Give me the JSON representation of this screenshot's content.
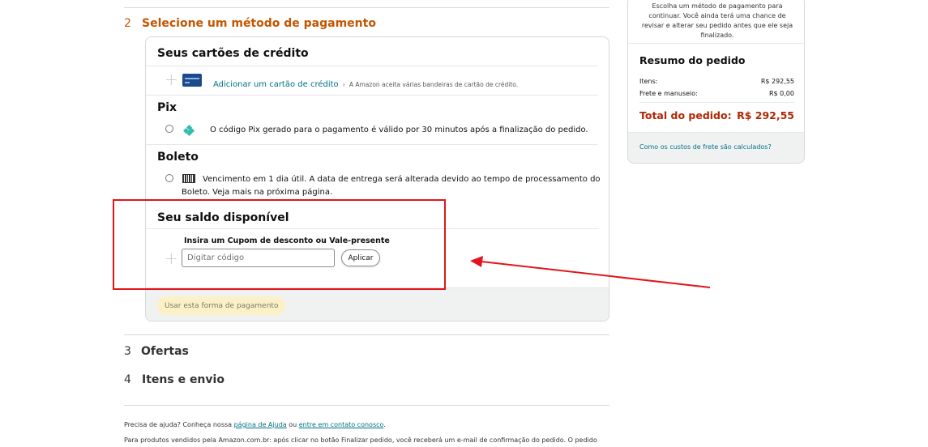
{
  "steps": [
    {
      "num": "2",
      "title": "Selecione um método de pagamento"
    },
    {
      "num": "3",
      "title": "Ofertas"
    },
    {
      "num": "4",
      "title": "Itens e envio"
    }
  ],
  "payment": {
    "cards": {
      "title": "Seus cartões de crédito",
      "add_link": "Adicionar um cartão de crédito",
      "chevron": "›",
      "note": "A Amazon aceita várias bandeiras de cartão de crédito."
    },
    "pix": {
      "title": "Pix",
      "description": "O código Pix gerado para o pagamento é válido por 30 minutos após a finalização do pedido."
    },
    "boleto": {
      "title": "Boleto",
      "description_line1": "Vencimento em 1 dia útil. A data de entrega será alterada devido ao tempo de processamento do",
      "description_line2": "Boleto. Veja mais na próxima página."
    },
    "balance": {
      "title": "Seu saldo disponível",
      "coupon_label": "Insira um Cupom de desconto ou Vale-presente",
      "coupon_placeholder": "Digitar código",
      "apply_label": "Aplicar"
    },
    "use_button": "Usar esta forma de pagamento"
  },
  "footer": {
    "help_prefix": "Precisa de ajuda? Conheça nossa ",
    "help_link": "página de Ajuda",
    "help_mid": " ou ",
    "contact_link": "entre em contato conosco",
    "help_suffix": ".",
    "line2": "Para produtos vendidos pela Amazon.com.br: após clicar no botão Finalizar pedido, você receberá um e-mail de confirmação do pedido. O pedido"
  },
  "summary": {
    "note": "Escolha um método de pagamento para continuar. Você ainda terá uma chance de revisar e alterar seu pedido antes que ele seja finalizado.",
    "title": "Resumo do pedido",
    "items_label": "Itens:",
    "items_value": "R$ 292,55",
    "shipping_label": "Frete e manuseio:",
    "shipping_value": "R$ 0,00",
    "total_label": "Total do pedido:",
    "total_value": "R$ 292,55",
    "shipping_link": "Como os custos de frete são calculados?"
  },
  "colors": {
    "active_step": "#c45500",
    "link": "#007185",
    "total": "#b12704",
    "highlight": "#e3141b"
  }
}
